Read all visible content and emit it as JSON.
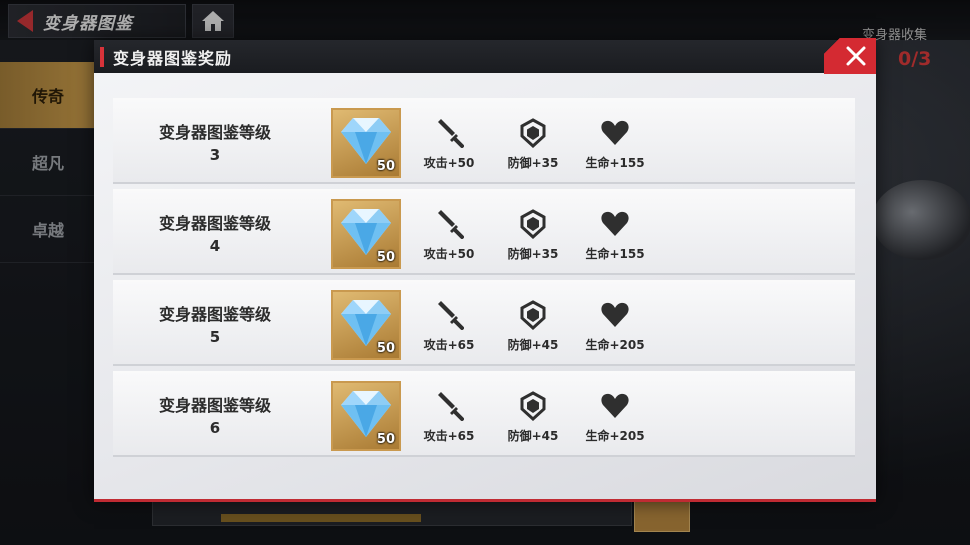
{
  "background": {
    "back_title": "变身器图鉴",
    "collection_label": "变身器收集",
    "collection_count": "0/3",
    "sidebar": [
      {
        "label": "传奇",
        "active": true
      },
      {
        "label": "超凡",
        "active": false
      },
      {
        "label": "卓越",
        "active": false
      }
    ]
  },
  "modal": {
    "title": "变身器图鉴奖励",
    "close_icon": "close-icon",
    "rows": [
      {
        "name": "变身器图鉴等级",
        "level": "3",
        "gem_count": "50",
        "attack": "攻击+50",
        "defense": "防御+35",
        "life": "生命+155"
      },
      {
        "name": "变身器图鉴等级",
        "level": "4",
        "gem_count": "50",
        "attack": "攻击+50",
        "defense": "防御+35",
        "life": "生命+155"
      },
      {
        "name": "变身器图鉴等级",
        "level": "5",
        "gem_count": "50",
        "attack": "攻击+65",
        "defense": "防御+45",
        "life": "生命+205"
      },
      {
        "name": "变身器图鉴等级",
        "level": "6",
        "gem_count": "50",
        "attack": "攻击+65",
        "defense": "防御+45",
        "life": "生命+205"
      }
    ]
  },
  "colors": {
    "accent": "#d42a32",
    "gold": "#c99b4a",
    "panel": "#eceef1"
  }
}
